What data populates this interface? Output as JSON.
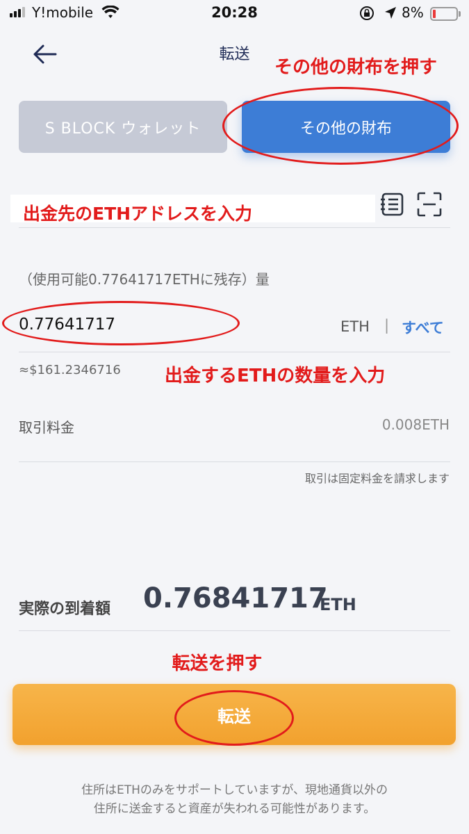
{
  "status_bar": {
    "carrier": "Y!mobile",
    "time": "20:28",
    "battery_pct": "8%",
    "battery_level": 0.08
  },
  "nav": {
    "title": "転送"
  },
  "annotations": {
    "press_other_wallet": "その他の財布を押す",
    "enter_address": "出金先のETHアドレスを入力",
    "enter_amount": "出金するETHの数量を入力",
    "press_transfer": "転送を押す"
  },
  "tabs": {
    "sblock": "S BLOCK ウォレット",
    "other": "その他の財布"
  },
  "address": {
    "value": "",
    "placeholder": ""
  },
  "amount": {
    "balance_label": "（使用可能0.77641717ETHに残存）量",
    "value": "0.77641717",
    "unit": "ETH",
    "separator": "|",
    "all_label": "すべて",
    "usd": "≈$161.2346716"
  },
  "fee": {
    "label": "取引料金",
    "value": "0.008ETH",
    "note": "取引は固定料金を請求します"
  },
  "arrival": {
    "label": "実際の到着額",
    "amount": "0.76841717",
    "unit": "ETH"
  },
  "transfer_button": "転送",
  "warning": {
    "line1": "住所はETHのみをサポートしていますが、現地通貨以外の",
    "line2": "住所に送金すると資産が失われる可能性があります。"
  },
  "colors": {
    "accent_blue": "#3d7dd6",
    "transfer_orange": "#f2a12e",
    "annotation_red": "#e21b1b"
  }
}
